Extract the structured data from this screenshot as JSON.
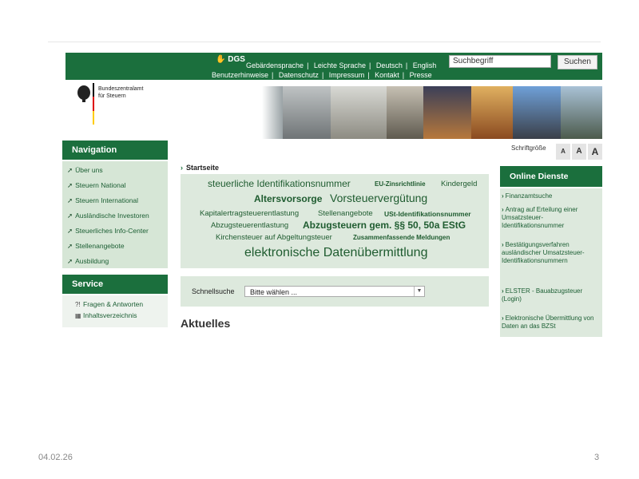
{
  "header": {
    "logo_text": "DGS",
    "links_row1": [
      "Gebärdensprache",
      "Leichte Sprache",
      "Deutsch",
      "English"
    ],
    "links_row2": [
      "Benutzerhinweise",
      "Datenschutz",
      "Impressum",
      "Kontakt",
      "Presse"
    ],
    "search_placeholder": "Suchbegriff",
    "search_button": "Suchen"
  },
  "brand": {
    "line1": "Bundeszentralamt",
    "line2": "für Steuern"
  },
  "navigation": {
    "title": "Navigation",
    "items": [
      "Über uns",
      "Steuern National",
      "Steuern International",
      "Ausländische Investoren",
      "Steuerliches Info-Center",
      "Stellenangebote",
      "Ausbildung"
    ]
  },
  "service": {
    "title": "Service",
    "items": [
      "Fragen & Antworten",
      "Inhaltsverzeichnis"
    ]
  },
  "fontsize": {
    "label": "Schriftgröße",
    "buttons": [
      "A",
      "A",
      "A"
    ]
  },
  "breadcrumb": "Startseite",
  "tagcloud": [
    "steuerliche Identifikationsnummer",
    "EU-Zinsrichtlinie",
    "Kindergeld",
    "Altersvorsorge",
    "Vorsteuervergütung",
    "Kapitalertragsteuerentlastung",
    "Stellenangebote",
    "USt-Identifikationsnummer",
    "Abzugsteuerentlastung",
    "Abzugsteuern gem. §§ 50, 50a EStG",
    "Kirchensteuer auf Abgeltungsteuer",
    "Zusammenfassende Meldungen",
    "elektronische Datenübermittlung"
  ],
  "quicksearch": {
    "label": "Schnellsuche",
    "selected": "Bitte wählen ..."
  },
  "section_title": "Aktuelles",
  "online_services": {
    "title": "Online Dienste",
    "items": [
      "Finanzamtsuche",
      "Antrag auf Erteilung einer Umsatzsteuer-Identifikationsnummer",
      "Bestätigungsverfahren ausländischer Umsatzsteuer-Identifikationsnummern",
      "ELSTER - Bauabzugsteuer (Login)",
      "Elektronische Übermittlung von Daten an das BZSt"
    ]
  },
  "footer": {
    "date": "04.02.26",
    "page": "3"
  },
  "colors": {
    "brand_green": "#1b6f3d",
    "panel_green": "#dde9dd"
  }
}
